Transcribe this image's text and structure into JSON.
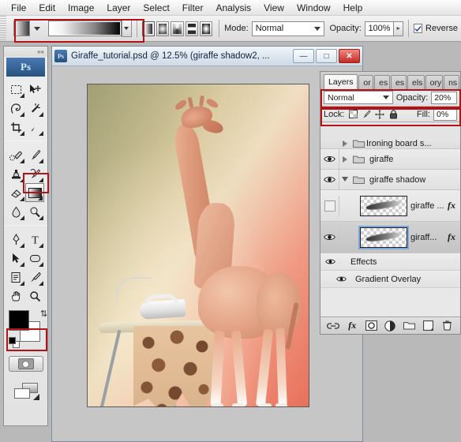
{
  "menu": {
    "items": [
      "File",
      "Edit",
      "Image",
      "Layer",
      "Select",
      "Filter",
      "Analysis",
      "View",
      "Window",
      "Help"
    ]
  },
  "options_bar": {
    "tool_preset_icon": "gradient-tool-icon",
    "gradient_preset_label": "",
    "gradient_types": [
      "linear-gradient-icon",
      "radial-gradient-icon",
      "angle-gradient-icon",
      "reflected-gradient-icon",
      "diamond-gradient-icon"
    ],
    "selected_gradient_type": 0,
    "mode_label": "Mode:",
    "mode_value": "Normal",
    "opacity_label": "Opacity:",
    "opacity_value": "100%",
    "reverse_label": "Reverse",
    "reverse_checked": true
  },
  "toolbar": {
    "collapse_icon": "««",
    "logo": "Ps",
    "tools": [
      {
        "name": "rectangular-marquee-tool",
        "icon": "marquee-icon"
      },
      {
        "name": "move-tool",
        "icon": "move-icon"
      },
      {
        "name": "lasso-tool",
        "icon": "lasso-icon"
      },
      {
        "name": "magic-wand-tool",
        "icon": "wand-icon"
      },
      {
        "name": "crop-tool",
        "icon": "crop-icon"
      },
      {
        "name": "slice-tool",
        "icon": "slice-icon"
      },
      {
        "name": "healing-brush-tool",
        "icon": "healing-icon"
      },
      {
        "name": "brush-tool",
        "icon": "brush-icon"
      },
      {
        "name": "clone-stamp-tool",
        "icon": "stamp-icon"
      },
      {
        "name": "history-brush-tool",
        "icon": "history-brush-icon"
      },
      {
        "name": "eraser-tool",
        "icon": "eraser-icon"
      },
      {
        "name": "gradient-tool",
        "icon": "gradient-icon",
        "selected": true
      },
      {
        "name": "blur-tool",
        "icon": "blur-drop-icon"
      },
      {
        "name": "dodge-tool",
        "icon": "dodge-icon"
      },
      {
        "name": "pen-tool",
        "icon": "pen-icon"
      },
      {
        "name": "type-tool",
        "icon": "type-T-icon"
      },
      {
        "name": "path-selection-tool",
        "icon": "path-arrow-icon"
      },
      {
        "name": "rounded-rectangle-tool",
        "icon": "shape-icon"
      },
      {
        "name": "notes-tool",
        "icon": "notes-icon"
      },
      {
        "name": "eyedropper-tool",
        "icon": "eyedropper-icon"
      },
      {
        "name": "hand-tool",
        "icon": "hand-icon"
      },
      {
        "name": "zoom-tool",
        "icon": "magnifier-icon"
      }
    ],
    "foreground_color": "#000000",
    "background_color": "#ffffff",
    "quick_mask_label": "quick-mask-button",
    "screen_mode_label": "screen-mode-button"
  },
  "document": {
    "title": "Giraffe_tutorial.psd @ 12.5% (giraffe shadow2, ...",
    "app_icon": "Ps",
    "minimize": "—",
    "maximize": "□",
    "close": "✕",
    "zoom_percent": "12.5%"
  },
  "layers_panel": {
    "tabs": [
      {
        "label": "Layers",
        "active": true,
        "closable": true
      },
      {
        "label": "or",
        "active": false
      },
      {
        "label": "es",
        "active": false
      },
      {
        "label": "es",
        "active": false
      },
      {
        "label": "els",
        "active": false
      },
      {
        "label": "ory",
        "active": false
      },
      {
        "label": "ns",
        "active": false
      }
    ],
    "close_glyph": "✕",
    "blend_mode": "Normal",
    "opacity_label": "Opacity:",
    "opacity_value": "20%",
    "lock_label": "Lock:",
    "lock_icons": [
      "lock-transparent-pixels-icon",
      "lock-image-pixels-icon",
      "lock-position-icon",
      "lock-all-icon"
    ],
    "fill_label": "Fill:",
    "fill_value": "0%",
    "clipped_top_row": "Ironing board s...",
    "rows": [
      {
        "name": "giraffe",
        "type": "group",
        "visible": true,
        "expanded": false
      },
      {
        "name": "giraffe shadow",
        "type": "group",
        "visible": true,
        "expanded": true
      },
      {
        "name": "giraffe ...",
        "type": "layer",
        "visible": false,
        "has_fx": true,
        "fx_glyph": "fx",
        "thumb": "shadow-thumbnail"
      },
      {
        "name": "giraff...",
        "type": "layer",
        "visible": true,
        "has_fx": true,
        "fx_glyph": "fx",
        "selected": true,
        "thumb": "shadow-thumbnail"
      }
    ],
    "effects_rows": [
      {
        "label": "Effects",
        "visible": true
      },
      {
        "label": "Gradient Overlay",
        "visible": true
      }
    ],
    "footer_buttons": [
      "link-layers-icon",
      "layer-style-fx-icon",
      "add-layer-mask-icon",
      "new-adjustment-layer-icon",
      "new-group-icon",
      "new-layer-icon",
      "delete-layer-icon"
    ]
  },
  "annotations": {
    "boxes": [
      {
        "name": "gradient-options-highlight"
      },
      {
        "name": "gradient-tool-highlight"
      },
      {
        "name": "quick-mask-highlight"
      },
      {
        "name": "blend-opacity-highlight"
      },
      {
        "name": "lock-fill-highlight"
      }
    ]
  }
}
